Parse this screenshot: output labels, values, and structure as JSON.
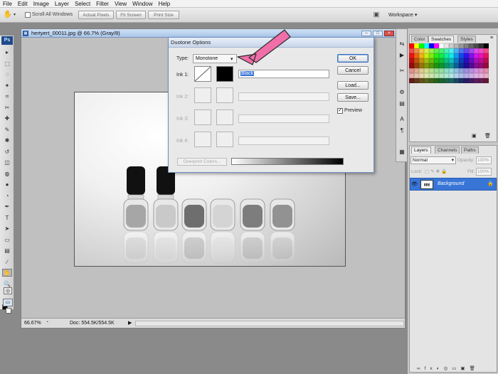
{
  "menu": [
    "File",
    "Edit",
    "Image",
    "Layer",
    "Select",
    "Filter",
    "View",
    "Window",
    "Help"
  ],
  "options_bar": {
    "scroll_all_windows": "Scroll All Windows",
    "actual_pixels": "Actual Pixels",
    "fit_screen": "Fit Screen",
    "print_size": "Print Size",
    "workspace": "Workspace"
  },
  "toolbox": {
    "logo": "Ps",
    "tools": [
      "move-icon",
      "marquee-icon",
      "lasso-icon",
      "magic-wand-icon",
      "crop-icon",
      "slice-icon",
      "healing-brush-icon",
      "brush-icon",
      "clone-stamp-icon",
      "history-brush-icon",
      "eraser-icon",
      "paint-bucket-icon",
      "blur-icon",
      "dodge-icon",
      "pen-icon",
      "type-icon",
      "path-selection-icon",
      "rectangle-icon",
      "notes-icon",
      "eyedropper-icon",
      "hand-icon",
      "zoom-icon"
    ],
    "glyphs": [
      "▸",
      "⬚",
      "◌",
      "✦",
      "⌗",
      "✂",
      "✚",
      "✎",
      "✱",
      "↺",
      "◫",
      "◍",
      "●",
      "◔",
      "✒",
      "T",
      "➤",
      "▭",
      "▤",
      "∕",
      "✋",
      "🔍"
    ]
  },
  "document": {
    "title": "hertyert_00011.jpg @ 66.7% (Gray/8)",
    "zoom": "66.67%",
    "doc_size": "Doc: 554.5K/554.5K",
    "bottle_cap_color": "#111111",
    "bottle_liquid_grays": [
      "#a6a6a6",
      "#c9c9c9",
      "#6e6e6e",
      "#d4d4d4",
      "#7d7d7d",
      "#929292"
    ]
  },
  "dialog": {
    "title": "Duotone Options",
    "type_label": "Type:",
    "type_value": "Monotone",
    "ink1_label": "Ink 1:",
    "ink1_name": "Black",
    "ink2_label": "Ink 2:",
    "ink3_label": "Ink 3:",
    "ink4_label": "Ink 4:",
    "overprint_colors": "Overprint Colors...",
    "ok": "OK",
    "cancel": "Cancel",
    "load": "Load...",
    "save": "Save...",
    "preview_label": "Preview",
    "preview_checked": true
  },
  "annotation_arrow_color": "#f06fa8",
  "panels": {
    "color_tabs": [
      "Color",
      "Swatches",
      "Styles"
    ],
    "active_color_tab": "Swatches",
    "layers_tabs": [
      "Layers",
      "Channels",
      "Paths"
    ],
    "blend_mode": "Normal",
    "opacity_label": "Opacity:",
    "opacity": "100%",
    "lock_label": "Lock:",
    "fill_label": "Fill:",
    "fill": "100%",
    "layer_name": "Background",
    "layer_highlight": "#3875d7"
  }
}
